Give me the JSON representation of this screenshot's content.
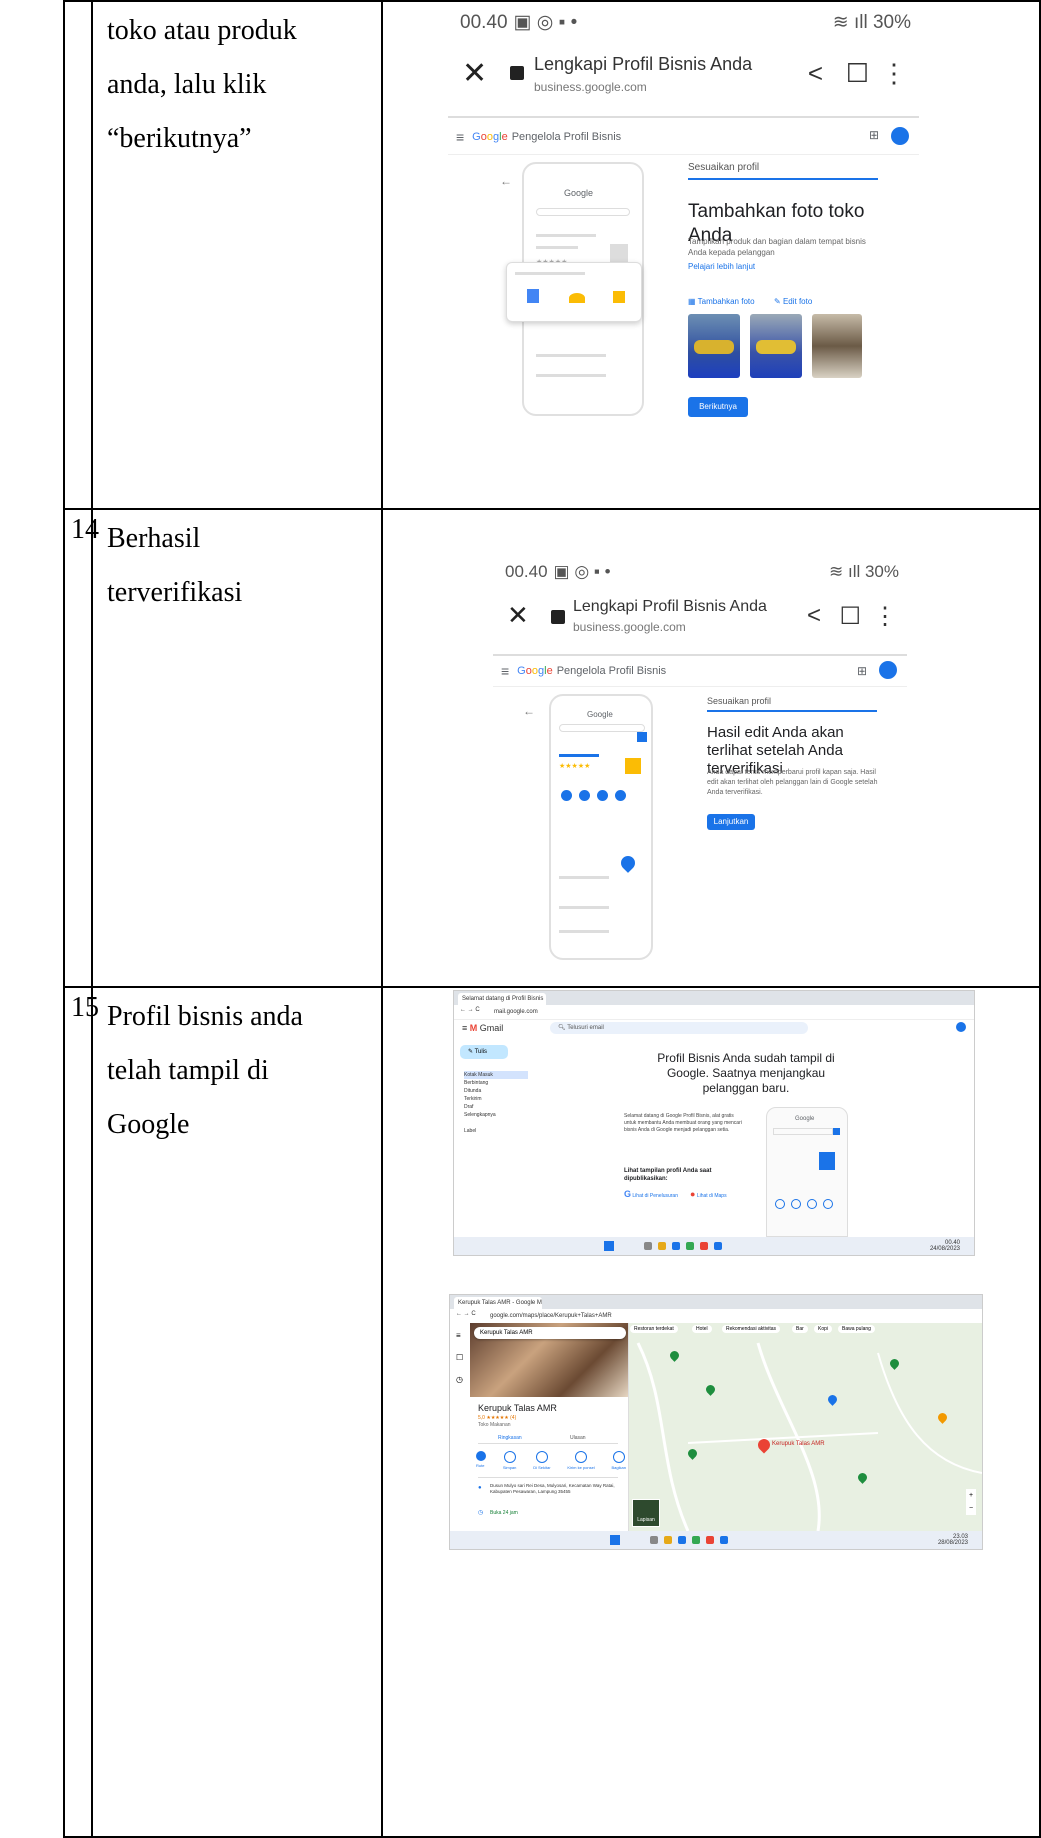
{
  "rows": [
    {
      "num": "",
      "desc": [
        "toko atau produk",
        "anda, lalu klik",
        "“berikutnya”"
      ],
      "phone": {
        "time": "00.40",
        "battery": "30%",
        "page_title": "Lengkapi Profil Bisnis Anda",
        "url": "business.google.com",
        "product": "Pengelola Profil Bisnis",
        "side_label": "Sesuaikan profil",
        "heading": "Tambahkan foto toko Anda",
        "body": "Tampilkan produk dan bagian dalam tempat bisnis Anda kepada pelanggan",
        "link": "Pelajari lebih lanjut",
        "add_photo": "Tambahkan foto",
        "edit_photo": "Edit foto",
        "button": "Berikutnya"
      }
    },
    {
      "num": "14",
      "desc": [
        "Berhasil",
        "terverifikasi"
      ],
      "phone": {
        "time": "00.40",
        "battery": "30%",
        "page_title": "Lengkapi Profil Bisnis Anda",
        "url": "business.google.com",
        "product": "Pengelola Profil Bisnis",
        "side_label": "Sesuaikan profil",
        "heading": "Hasil edit Anda akan terlihat setelah Anda terverifikasi",
        "body": "Anda dapat terus memperbarui profil kapan saja. Hasil edit akan terlihat oleh pelanggan lain di Google setelah Anda terverifikasi.",
        "button": "Lanjutkan"
      }
    },
    {
      "num": "15",
      "desc": [
        "Profil bisnis anda",
        "telah tampil di",
        "Google"
      ],
      "gmail": {
        "tab": "Selamat datang di Profil Bisnis",
        "url": "mail.google.com",
        "app": "Gmail",
        "search": "Telusuri email",
        "compose": "Tulis",
        "nav": [
          "Kotak Masuk",
          "Berbintang",
          "Ditunda",
          "Terkirim",
          "Draf",
          "Selengkapnya"
        ],
        "label_heading": "Label",
        "headline": "Profil Bisnis Anda sudah tampil di Google. Saatnya menjangkau pelanggan baru.",
        "body": "Selamat datang di Google Profil Bisnis, alat gratis untuk membantu Anda membuat orang yang mencari bisnis Anda di Google menjadi pelanggan setia.",
        "see_label": "Lihat tampilan profil Anda saat dipublikasikan:",
        "btn_search": "Lihat di Penelusuran",
        "btn_maps": "Lihat di Maps",
        "clock_time": "00.40",
        "clock_date": "24/08/2023"
      },
      "maps": {
        "tab": "Kerupuk Talas AMR - Google Maps",
        "url": "google.com/maps/place/Kerupuk+Talas+AMR",
        "search": "Kerupuk Talas AMR",
        "name": "Kerupuk Talas AMR",
        "rating": "5,0 ★★★★★ (4)",
        "category": "Toko Makanan",
        "tabs": [
          "Ringkasan",
          "Ulasan"
        ],
        "actions": [
          "Rute",
          "Simpan",
          "Di Sekitar",
          "Kirim ke ponsel",
          "Bagikan"
        ],
        "address": "Dusun Mulyo sari Rei Desa, Mulyosari, Kecamatan Way Ratai, Kabupaten Pesawaran, Lampung 35455",
        "hours": "Buka 24 jam",
        "pin_label": "Kerupuk Talas AMR",
        "chips": [
          "Restoran terdekat",
          "Hotel",
          "Rekomendasi aktivitas",
          "Bar",
          "Kopi",
          "Bawa pulang"
        ],
        "layer": "Lapisan",
        "clock_time": "23.03",
        "clock_date": "28/08/2023"
      }
    }
  ],
  "colors": {
    "google_blue": "#1a73e8",
    "map_green": "#e8f0e2",
    "pin_red": "#ea4335"
  }
}
